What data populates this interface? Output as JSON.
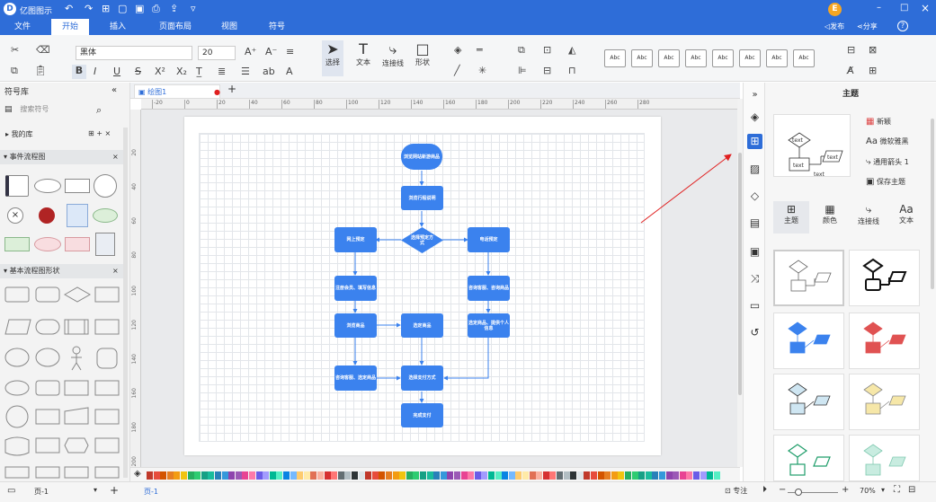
{
  "app": {
    "name": "亿图图示",
    "user_initial": "E"
  },
  "window": {
    "minimize": "–",
    "maximize": "□",
    "close": "×"
  },
  "menu": {
    "tabs": [
      "文件",
      "开始",
      "插入",
      "页面布局",
      "视图",
      "符号"
    ],
    "publish": "发布",
    "share": "分享",
    "help": "?"
  },
  "ribbon": {
    "font_family": "黑体",
    "font_size": "20",
    "select_label": "选择",
    "text_label": "文本",
    "connector_label": "连接线",
    "shape_label": "形状",
    "style_sample": "Abc"
  },
  "left_panel": {
    "title": "符号库",
    "search_placeholder": "搜索符号",
    "my_library": "我的库",
    "section1": "事件流程图",
    "section2": "基本流程图形状"
  },
  "doc_tab": {
    "name": "绘图1",
    "add": "+"
  },
  "ruler": {
    "h_ticks": [
      "-20",
      "0",
      "20",
      "40",
      "60",
      "80",
      "100",
      "120",
      "140",
      "160",
      "180",
      "200",
      "220",
      "240",
      "260",
      "280"
    ],
    "v_ticks": [
      "20",
      "40",
      "60",
      "80",
      "100",
      "120",
      "140",
      "160",
      "180",
      "200"
    ]
  },
  "flowchart": {
    "start": "浏览网站新游商品",
    "browse": "浏览行程说明",
    "decision": "选择预定方式",
    "online": "网上预定",
    "phone": "电话预定",
    "register": "注册会员、填写信息",
    "consult": "咨询客服、咨询商品",
    "view": "浏览商品",
    "select_goods": "选定商品",
    "submit": "选定商品、提供个人信息",
    "consult2": "咨询客服、选定商品",
    "pay_method": "选择支付方式",
    "done": "完成支付"
  },
  "right_panel": {
    "title": "主题",
    "menu_new": "新颖",
    "menu_font": "微软雅黑",
    "menu_arrow": "通用箭头 1",
    "menu_save": "保存主题",
    "tabs": [
      "主题",
      "颜色",
      "连接线",
      "文本"
    ],
    "preview_text": [
      "text",
      "text",
      "text",
      "text"
    ]
  },
  "status": {
    "page_select": "页-1",
    "page_tab": "页-1",
    "add_page": "+",
    "focus": "专注",
    "zoom": "70%"
  },
  "colors": {
    "accent": "#2e6dd8",
    "node": "#3b82ee",
    "arrow": "#e02020"
  }
}
